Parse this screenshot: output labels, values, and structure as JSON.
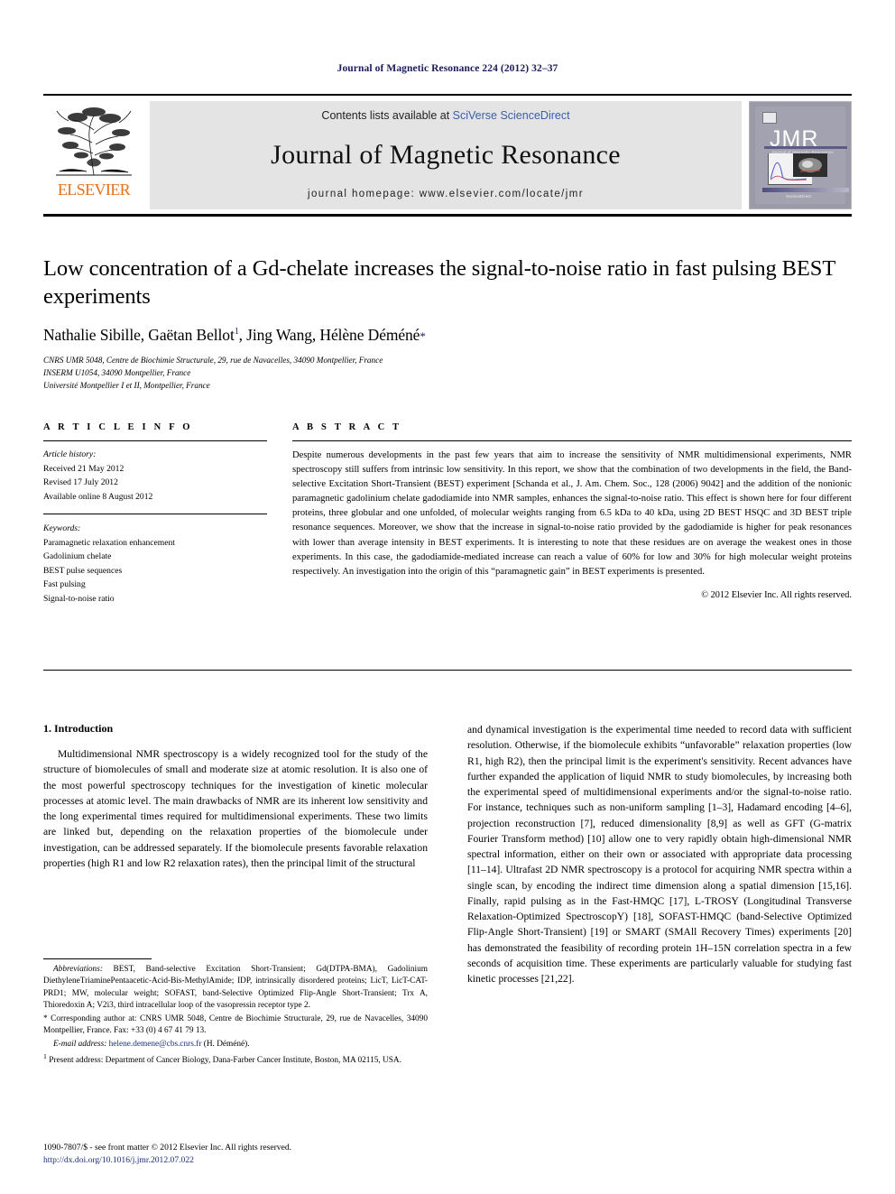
{
  "running_head": "Journal of Magnetic Resonance 224 (2012) 32–37",
  "masthead": {
    "contents_prefix": "Contents lists available at ",
    "sciencedirect": "SciVerse ScienceDirect",
    "journal_name": "Journal of Magnetic Resonance",
    "homepage": "journal homepage: www.elsevier.com/locate/jmr",
    "publisher": "ELSEVIER",
    "cover": {
      "title": "JMR",
      "subtitle": "Journal of Magnetic Resonance",
      "footer": "ScienceDirect"
    },
    "accent_orange": "#E8701A",
    "link_blue": "#3a5fa8"
  },
  "title": "Low concentration of a Gd-chelate increases the signal-to-noise ratio in fast pulsing BEST experiments",
  "authors": {
    "a1": "Nathalie Sibille, Gaëtan Bellot",
    "a1_sup": "1",
    "a2": ", Jing Wang, Hélène Déméné",
    "corresponding_mark": "*"
  },
  "affiliations": [
    "CNRS UMR 5048, Centre de Biochimie Structurale, 29, rue de Navacelles, 34090 Montpellier, France",
    "INSERM U1054, 34090 Montpellier, France",
    "Université Montpellier I et II, Montpellier, France"
  ],
  "article_info": {
    "heading": "A R T I C L E   I N F O",
    "history_label": "Article history:",
    "history": [
      "Received 21 May 2012",
      "Revised 17 July 2012",
      "Available online 8 August 2012"
    ],
    "keywords_label": "Keywords:",
    "keywords": [
      "Paramagnetic relaxation enhancement",
      "Gadolinium chelate",
      "BEST pulse sequences",
      "Fast pulsing",
      "Signal-to-noise ratio"
    ]
  },
  "abstract": {
    "heading": "A B S T R A C T",
    "text": "Despite numerous developments in the past few years that aim to increase the sensitivity of NMR multidimensional experiments, NMR spectroscopy still suffers from intrinsic low sensitivity. In this report, we show that the combination of two developments in the field, the Band-selective Excitation Short-Transient (BEST) experiment [Schanda et al., J. Am. Chem. Soc., 128 (2006) 9042] and the addition of the nonionic paramagnetic gadolinium chelate gadodiamide into NMR samples, enhances the signal-to-noise ratio. This effect is shown here for four different proteins, three globular and one unfolded, of molecular weights ranging from 6.5 kDa to 40 kDa, using 2D BEST HSQC and 3D BEST triple resonance sequences. Moreover, we show that the increase in signal-to-noise ratio provided by the gadodiamide is higher for peak resonances with lower than average intensity in BEST experiments. It is interesting to note that these residues are on average the weakest ones in those experiments. In this case, the gadodiamide-mediated increase can reach a value of 60% for low and 30% for high molecular weight proteins respectively. An investigation into the origin of this “paramagnetic gain” in BEST experiments is presented.",
    "copyright": "© 2012 Elsevier Inc. All rights reserved."
  },
  "introduction": {
    "heading": "1. Introduction",
    "left_paragraph_1": "Multidimensional NMR spectroscopy is a widely recognized tool for the study of the structure of biomolecules of small and moderate size at atomic resolution. It is also one of the most powerful spectroscopy techniques for the investigation of kinetic molecular processes at atomic level. The main drawbacks of NMR are its inherent low sensitivity and the long experimental times required for multidimensional experiments. These two limits are linked but, depending on the relaxation properties of the biomolecule under investigation, can be addressed separately. If the biomolecule presents favorable relaxation properties (high R1 and low R2 relaxation rates), then the principal limit of the structural",
    "right_paragraph_1": "and dynamical investigation is the experimental time needed to record data with sufficient resolution. Otherwise, if the biomolecule exhibits “unfavorable” relaxation properties (low R1, high R2), then the principal limit is the experiment's sensitivity. Recent advances have further expanded the application of liquid NMR to study biomolecules, by increasing both the experimental speed of multidimensional experiments and/or the signal-to-noise ratio. For instance, techniques such as non-uniform sampling [1–3], Hadamard encoding [4–6], projection reconstruction [7], reduced dimensionality [8,9] as well as GFT (G-matrix Fourier Transform method) [10] allow one to very rapidly obtain high-dimensional NMR spectral information, either on their own or associated with appropriate data processing [11–14]. Ultrafast 2D NMR spectroscopy is a protocol for acquiring NMR spectra within a single scan, by encoding the indirect time dimension along a spatial dimension [15,16]. Finally, rapid pulsing as in the Fast-HMQC [17], L-TROSY (Longitudinal Transverse Relaxation-Optimized SpectroscopY) [18], SOFAST-HMQC (band-Selective Optimized Flip-Angle Short-Transient) [19] or SMART (SMAll Recovery Times) experiments [20] has demonstrated the feasibility of recording protein 1H–15N correlation spectra in a few seconds of acquisition time. These experiments are particularly valuable for studying fast kinetic processes [21,22]."
  },
  "footnotes": {
    "abbreviations_label": "Abbreviations:",
    "abbreviations_text": "BEST, Band-selective Excitation Short-Transient; Gd(DTPA-BMA), Gadolinium DiethyleneTriaminePentaacetic-Acid-Bis-MethylAmide; IDP, intrinsically disordered proteins; LicT, LicT-CAT-PRD1; MW, molecular weight; SOFAST, band-Selective Optimized Flip-Angle Short-Transient; Trx A, Thioredoxin A; V2i3, third intracellular loop of the vasopressin receptor type 2.",
    "corresponding_mark": "*",
    "corresponding_text": "Corresponding author at: CNRS UMR 5048, Centre de Biochimie Structurale, 29, rue de Navacelles, 34090 Montpellier, France. Fax: +33 (0) 4 67 41 79 13.",
    "email_label": "E-mail address:",
    "email": "helene.demene@cbs.cnrs.fr",
    "email_owner": "(H. Déméné).",
    "present_mark": "1",
    "present_text": "Present address: Department of Cancer Biology, Dana-Farber Cancer Institute, Boston, MA 02115, USA."
  },
  "footer": {
    "issn_line": "1090-7807/$ - see front matter © 2012 Elsevier Inc. All rights reserved.",
    "doi": "http://dx.doi.org/10.1016/j.jmr.2012.07.022"
  }
}
